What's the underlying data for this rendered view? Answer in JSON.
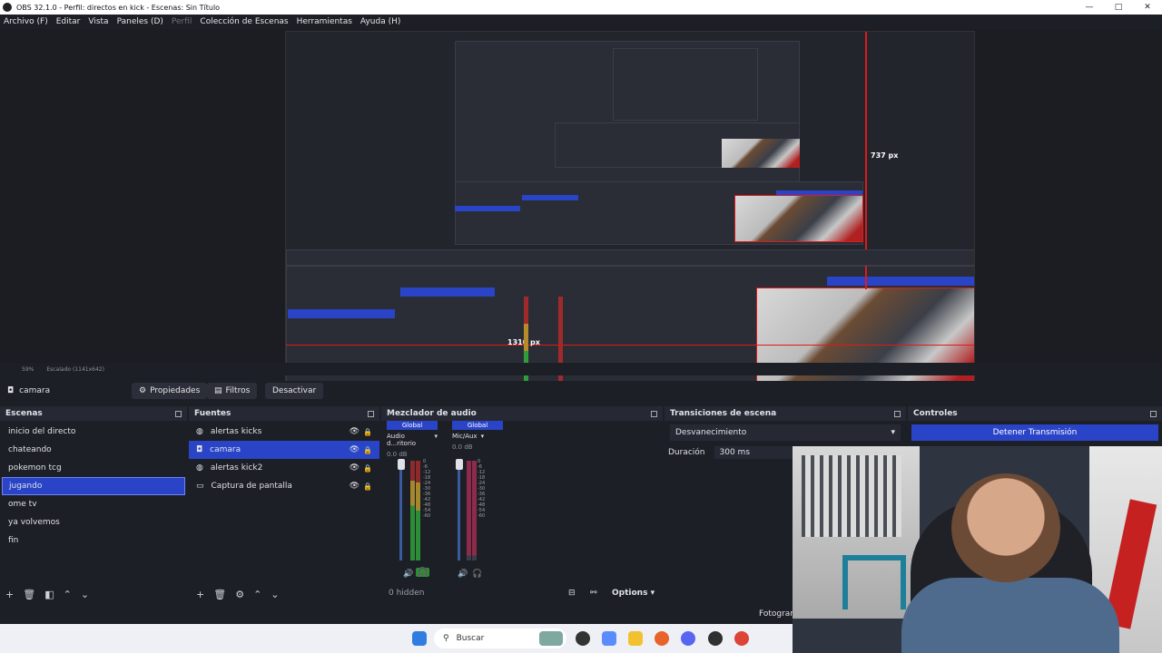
{
  "window": {
    "title": "OBS 32.1.0 - Perfil: directos en kick - Escenas: Sin Título",
    "controls": [
      "—",
      "□",
      "✕"
    ]
  },
  "menu": [
    "Archivo (F)",
    "Editar",
    "Vista",
    "Paneles (D)",
    "Perfil",
    "Colección de Escenas",
    "Herramientas",
    "Ayuda (H)"
  ],
  "preview": {
    "measure_h": "737 px",
    "measure_w": "1310 px",
    "zoom": "59%",
    "scale_mode": "Escalado (1141x642)"
  },
  "source_toolbar": {
    "source_name": "camara",
    "properties": "Propiedades",
    "filters": "Filtros",
    "deactivate": "Desactivar"
  },
  "scenes": {
    "title": "Escenas",
    "items": [
      "inicio del directo",
      "chateando",
      "pokemon tcg",
      "jugando",
      "ome tv",
      "ya volvemos",
      "fin"
    ],
    "selected_index": 3
  },
  "sources": {
    "title": "Fuentes",
    "items": [
      {
        "name": "alertas kicks",
        "icon": "globe-icon"
      },
      {
        "name": "camara",
        "icon": "camera-icon"
      },
      {
        "name": "alertas kick2",
        "icon": "globe-icon"
      },
      {
        "name": "Captura de pantalla",
        "icon": "monitor-icon"
      }
    ],
    "selected_index": 1
  },
  "mixer": {
    "title": "Mezclador de audio",
    "channels": [
      {
        "tag": "Global",
        "name": "Audio d...ritorio",
        "db": "0.0 dB"
      },
      {
        "tag": "Global",
        "name": "Mic/Aux",
        "db": "0.0 dB"
      }
    ],
    "scale": [
      "0",
      "-6",
      "-12",
      "-18",
      "-24",
      "-30",
      "-36",
      "-42",
      "-48",
      "-54",
      "-60"
    ],
    "hidden": "0 hidden",
    "options": "Options"
  },
  "transitions": {
    "title": "Transiciones de escena",
    "selected": "Desvanecimiento",
    "duration_label": "Duración",
    "duration_value": "300 ms"
  },
  "controls": {
    "title": "Controles",
    "stop_stream": "Detener Transmisión"
  },
  "statusbar": {
    "fps_label": "Fotogram"
  },
  "taskbar": {
    "search_placeholder": "Buscar"
  },
  "colors": {
    "accent": "#2a44c8",
    "background": "#1d1f26",
    "recording_red": "#e01919"
  }
}
